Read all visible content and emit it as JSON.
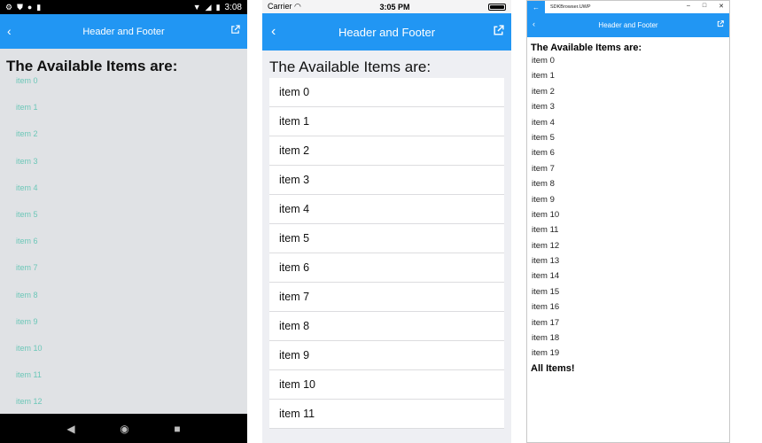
{
  "android": {
    "status": {
      "time": "3:08"
    },
    "nav_title": "Header and Footer",
    "header": "The Available Items are:",
    "items": [
      "item 0",
      "item 1",
      "item 2",
      "item 3",
      "item 4",
      "item 5",
      "item 6",
      "item 7",
      "item 8",
      "item 9",
      "item 10",
      "item 11",
      "item 12"
    ],
    "colors": {
      "bar": "#2196f3",
      "item_text": "#6cc7b8",
      "background": "#e0e2e5"
    }
  },
  "ios": {
    "status": {
      "carrier": "Carrier",
      "time": "3:05 PM"
    },
    "nav_title": "Header and Footer",
    "header": "The Available Items are:",
    "items": [
      "item 0",
      "item 1",
      "item 2",
      "item 3",
      "item 4",
      "item 5",
      "item 6",
      "item 7",
      "item 8",
      "item 9",
      "item 10",
      "item 11"
    ],
    "colors": {
      "bar": "#2196f3",
      "background": "#eeeff3"
    }
  },
  "uwp": {
    "window_title": "SDKBrowser.UWP",
    "nav_title": "Header and Footer",
    "header": "The Available Items are:",
    "items": [
      "item 0",
      "item 1",
      "item 2",
      "item 3",
      "item 4",
      "item 5",
      "item 6",
      "item 7",
      "item 8",
      "item 9",
      "item 10",
      "item 11",
      "item 12",
      "item 13",
      "item 14",
      "item 15",
      "item 16",
      "item 17",
      "item 18",
      "item 19"
    ],
    "footer": "All Items!",
    "colors": {
      "bar": "#2196f3"
    }
  },
  "icons": {
    "back": "chevron-left-icon",
    "external": "external-link-icon"
  }
}
